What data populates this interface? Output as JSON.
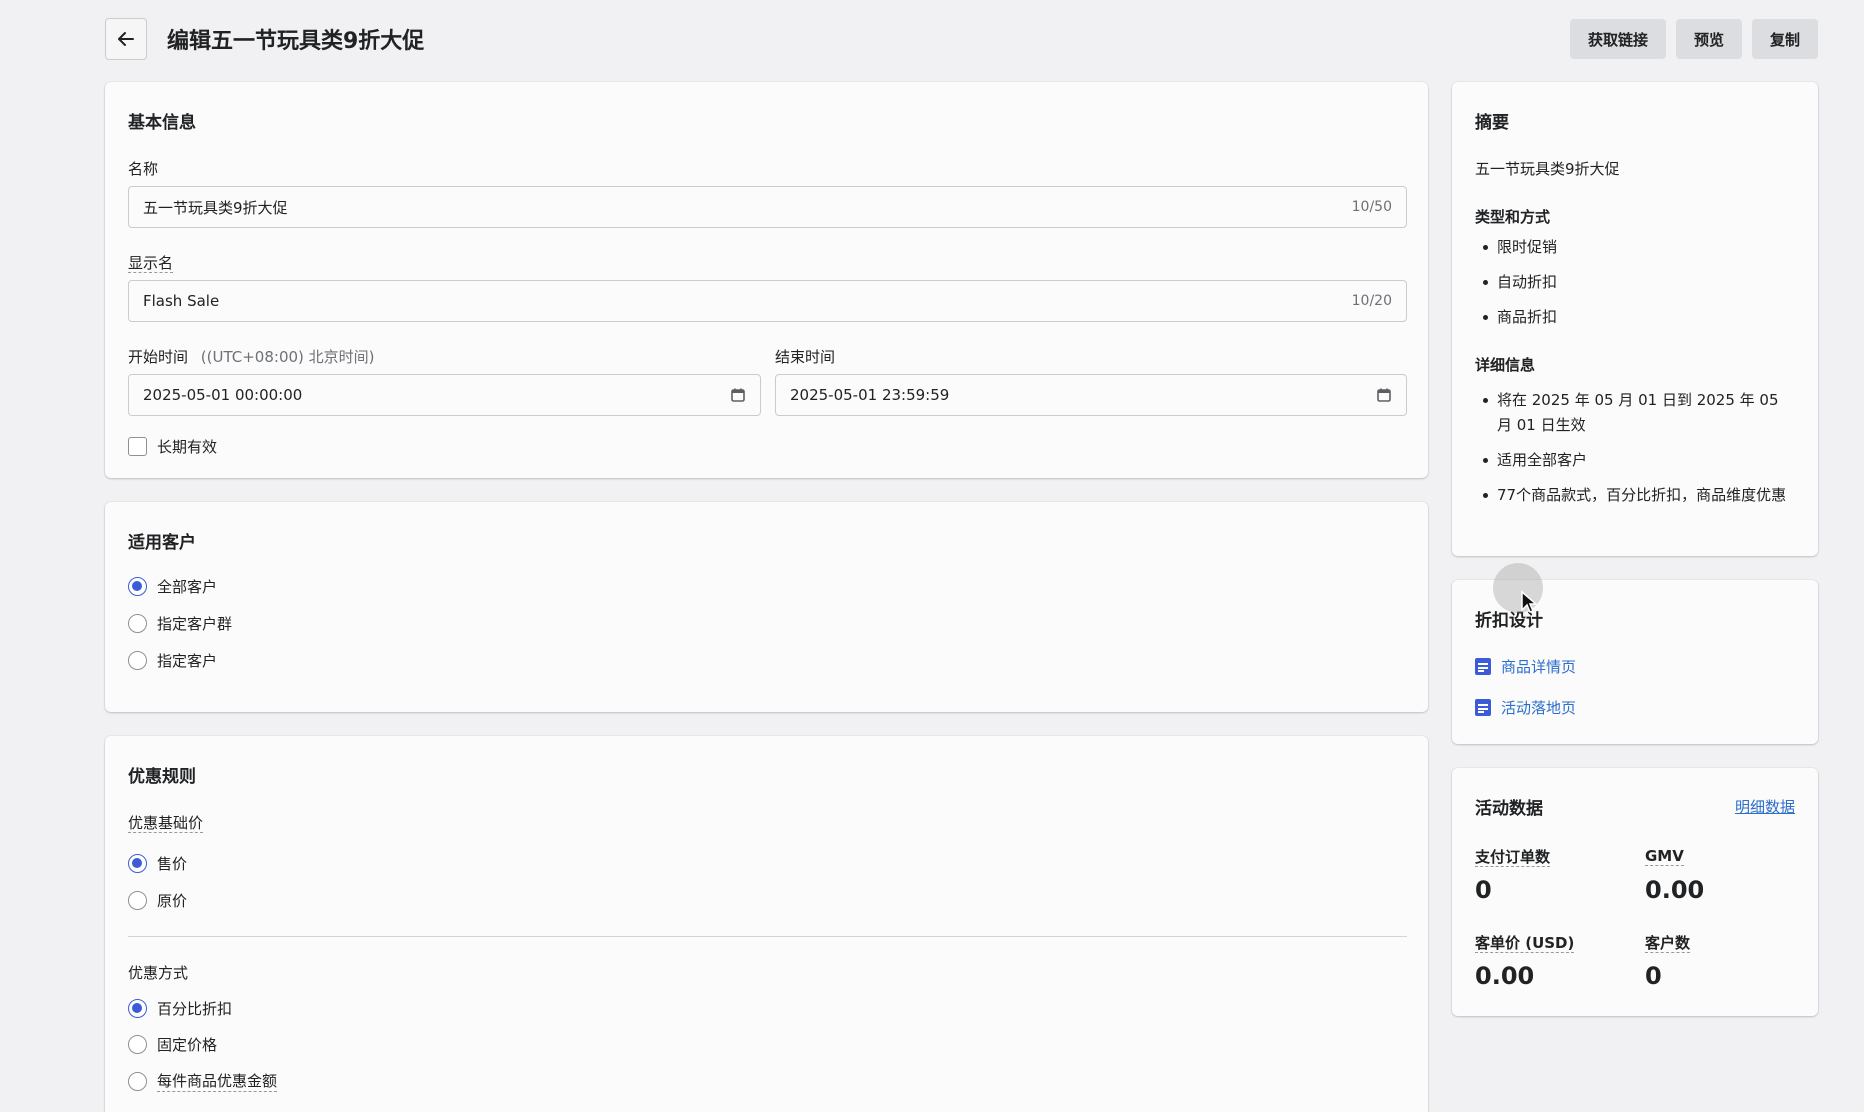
{
  "header": {
    "title": "编辑五一节玩具类9折大促",
    "actions": {
      "get_link": "获取链接",
      "preview": "预览",
      "duplicate": "复制"
    }
  },
  "basic_info": {
    "title": "基本信息",
    "name_label": "名称",
    "name_value": "五一节玩具类9折大促",
    "name_count": "10/50",
    "display_label": "显示名",
    "display_value": "Flash Sale",
    "display_count": "10/20",
    "start_label": "开始时间",
    "timezone": "((UTC+08:00) 北京时间)",
    "start_value": "2025-05-01 00:00:00",
    "end_label": "结束时间",
    "end_value": "2025-05-01 23:59:59",
    "long_term_label": "长期有效"
  },
  "customers": {
    "title": "适用客户",
    "options": [
      "全部客户",
      "指定客户群",
      "指定客户"
    ],
    "selected": "全部客户"
  },
  "rules": {
    "title": "优惠规则",
    "base_label": "优惠基础价",
    "base_options": [
      "售价",
      "原价"
    ],
    "method_label": "优惠方式",
    "method_options": [
      "百分比折扣",
      "固定价格",
      "每件商品优惠金额"
    ]
  },
  "summary": {
    "title": "摘要",
    "name": "五一节玩具类9折大促",
    "type_title": "类型和方式",
    "types": [
      "限时促销",
      "自动折扣",
      "商品折扣"
    ],
    "detail_title": "详细信息",
    "details": [
      "将在 2025 年 05 月 01 日到 2025 年 05 月 01 日生效",
      "适用全部客户",
      "77个商品款式，百分比折扣，商品维度优惠"
    ]
  },
  "design": {
    "title": "折扣设计",
    "links": [
      "商品详情页",
      "活动落地页"
    ]
  },
  "activity": {
    "title": "活动数据",
    "detail_link": "明细数据",
    "orders_label": "支付订单数",
    "orders_value": "0",
    "gmv_label": "GMV",
    "gmv_value": "0.00",
    "aov_label": "客单价 (USD)",
    "aov_value": "0.00",
    "customers_label": "客户数",
    "customers_value": "0"
  }
}
